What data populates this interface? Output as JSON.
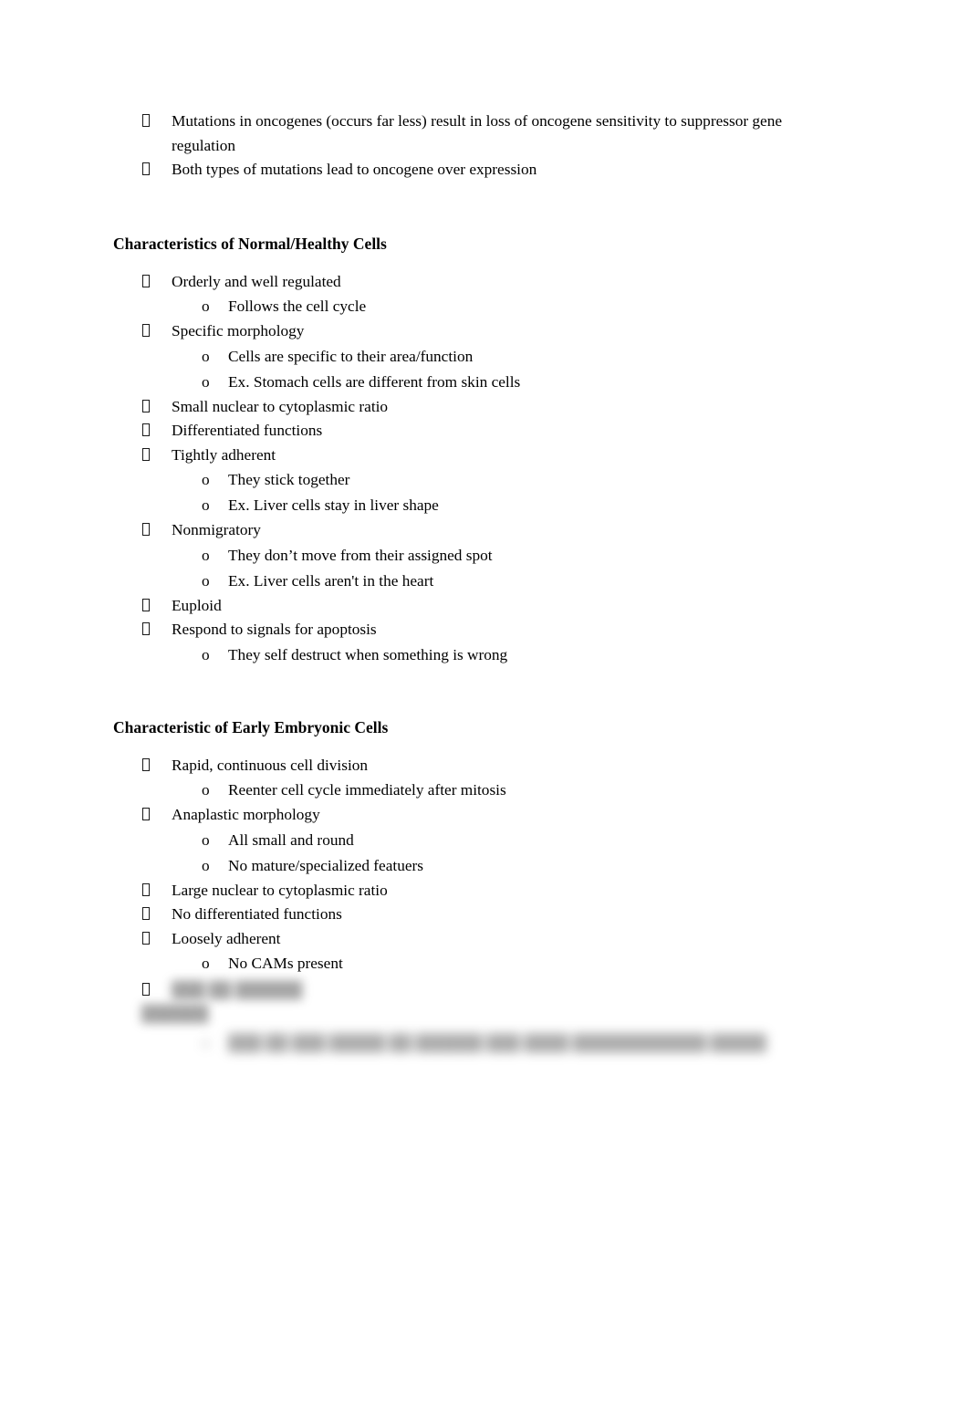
{
  "document": {
    "page_background": "#ffffff",
    "text_color": "#000000",
    "bullet_glyph": "missing-glyph-box",
    "sub_bullet_marker": "o"
  },
  "sections": [
    {
      "id": "oncogene-carryover",
      "heading": null,
      "items": [
        {
          "level": 1,
          "text": "Mutations in oncogenes (occurs far less) result in loss of oncogene sensitivity to suppressor gene regulation"
        },
        {
          "level": 1,
          "text": "Both types of mutations lead to oncogene over expression"
        }
      ]
    },
    {
      "id": "normal-healthy-cells",
      "heading": "Characteristics of Normal/Healthy Cells",
      "items": [
        {
          "level": 1,
          "text": "Orderly and well regulated"
        },
        {
          "level": 2,
          "text": "Follows the cell cycle"
        },
        {
          "level": 1,
          "text": "Specific morphology"
        },
        {
          "level": 2,
          "text": "Cells are specific to their area/function"
        },
        {
          "level": 2,
          "text": "Ex. Stomach cells are different from skin cells"
        },
        {
          "level": 1,
          "text": "Small nuclear to cytoplasmic ratio"
        },
        {
          "level": 1,
          "text": "Differentiated functions"
        },
        {
          "level": 1,
          "text": "Tightly adherent"
        },
        {
          "level": 2,
          "text": "They stick together"
        },
        {
          "level": 2,
          "text": "Ex. Liver cells stay in liver shape"
        },
        {
          "level": 1,
          "text": "Nonmigratory"
        },
        {
          "level": 2,
          "text": "They don’t move from their assigned spot"
        },
        {
          "level": 2,
          "text": "Ex. Liver cells aren't in the heart"
        },
        {
          "level": 1,
          "text": "Euploid"
        },
        {
          "level": 1,
          "text": "Respond to signals for apoptosis"
        },
        {
          "level": 2,
          "text": "They self destruct when something is wrong"
        }
      ]
    },
    {
      "id": "early-embryonic-cells",
      "heading": "Characteristic of Early Embryonic Cells",
      "items": [
        {
          "level": 1,
          "text": "Rapid, continuous cell division"
        },
        {
          "level": 2,
          "text": "Reenter cell cycle immediately after mitosis"
        },
        {
          "level": 1,
          "text": "Anaplastic morphology"
        },
        {
          "level": 2,
          "text": "All small and round"
        },
        {
          "level": 2,
          "text": "No mature/specialized featuers"
        },
        {
          "level": 1,
          "text": "Large nuclear to cytoplasmic ratio"
        },
        {
          "level": 1,
          "text": "No differentiated functions"
        },
        {
          "level": 1,
          "text": "Loosely adherent"
        },
        {
          "level": 2,
          "text": "No CAMs present"
        }
      ]
    }
  ],
  "redacted": {
    "note": "blurred-illegible-text",
    "lines": [
      {
        "level": 1,
        "placeholder": "███ ██ ██████"
      },
      {
        "level": 1,
        "placeholder": "██████"
      },
      {
        "level": 2,
        "placeholder": "███ ██ ███ █████ ██ ██████ ███ ████ ████████████ █████"
      }
    ]
  }
}
